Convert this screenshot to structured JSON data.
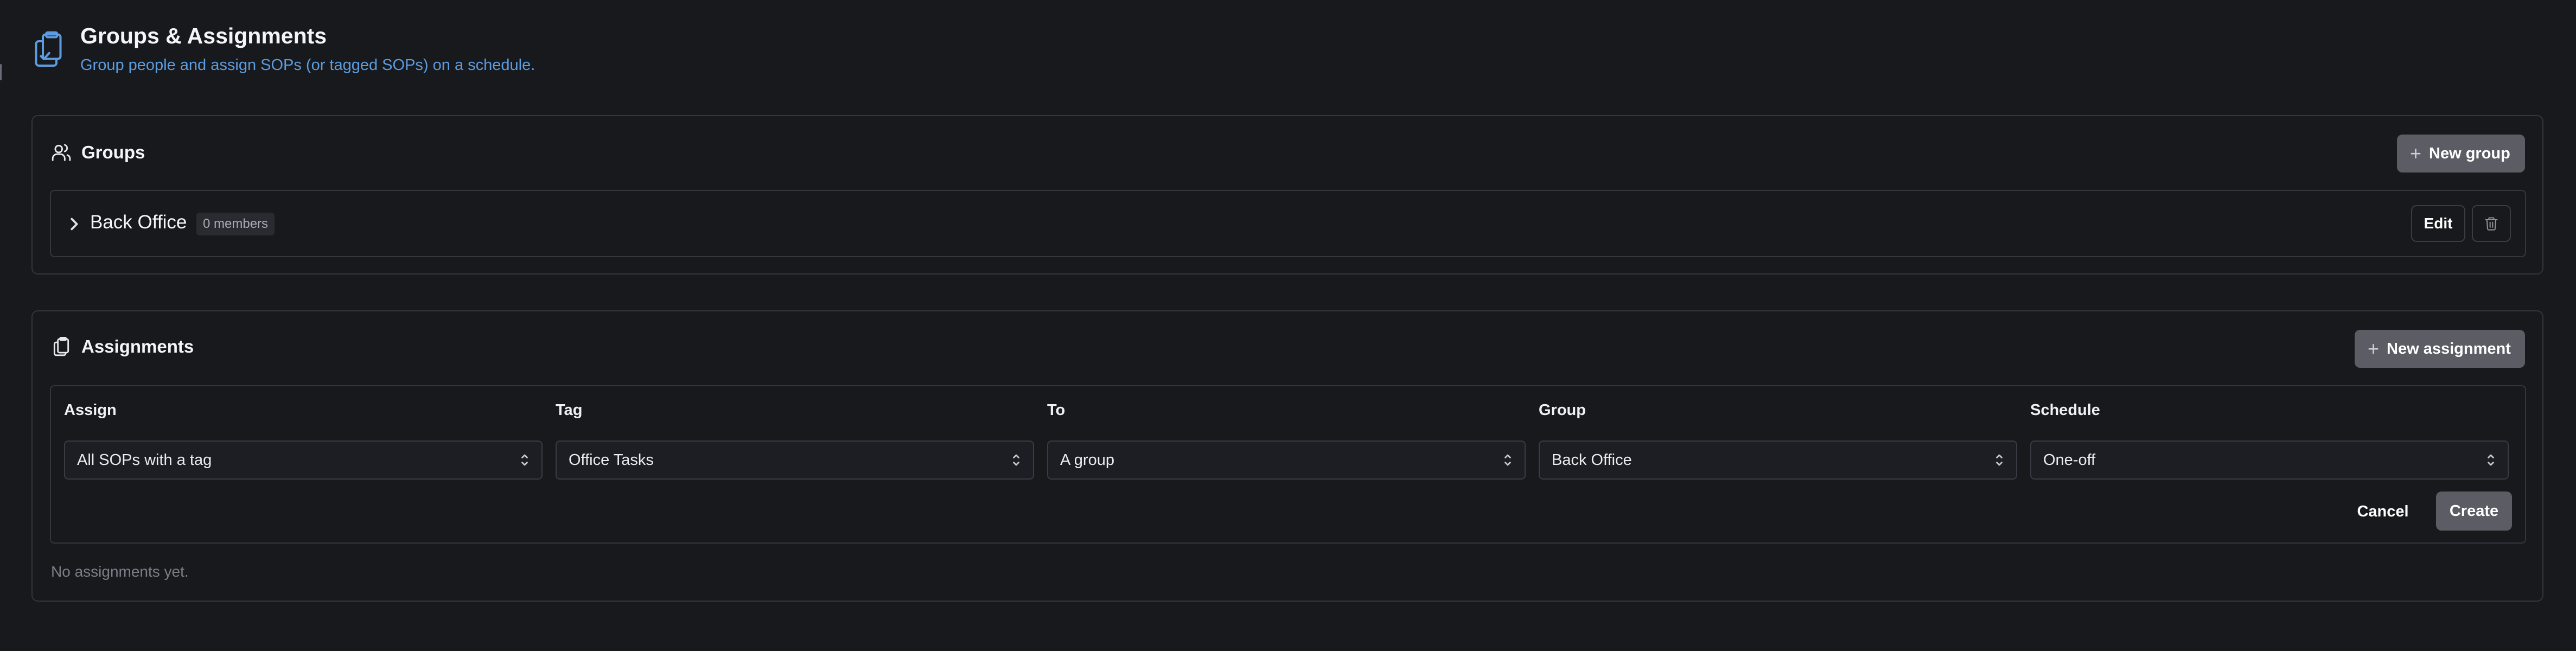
{
  "header": {
    "title": "Groups & Assignments",
    "subtitle": "Group people and assign SOPs (or tagged SOPs) on a schedule.",
    "icon": "clipboard-copy-icon",
    "accent_color": "#5c9ce0"
  },
  "groups": {
    "title": "Groups",
    "icon": "users-icon",
    "new_button_label": "New group",
    "items": [
      {
        "name": "Back Office",
        "members_badge": "0 members",
        "edit_label": "Edit"
      }
    ]
  },
  "assignments": {
    "title": "Assignments",
    "icon": "clipboard-icon",
    "new_button_label": "New assignment",
    "form": {
      "fields": [
        {
          "label": "Assign",
          "value": "All SOPs with a tag"
        },
        {
          "label": "Tag",
          "value": "Office Tasks"
        },
        {
          "label": "To",
          "value": "A group"
        },
        {
          "label": "Group",
          "value": "Back Office"
        },
        {
          "label": "Schedule",
          "value": "One-off"
        }
      ],
      "cancel_label": "Cancel",
      "create_label": "Create"
    },
    "empty_text": "No assignments yet."
  }
}
